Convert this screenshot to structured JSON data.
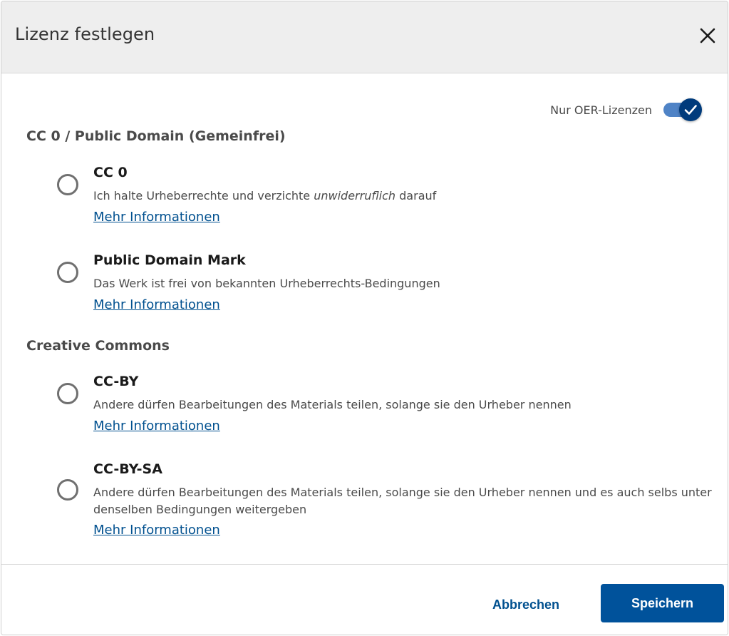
{
  "dialog": {
    "title": "Lizenz festlegen",
    "close_icon": "close-icon"
  },
  "oer_toggle": {
    "label": "Nur OER-Lizenzen",
    "checked": true,
    "knob_icon": "checkmark-icon"
  },
  "sections": [
    {
      "title": "CC 0 / Public Domain (Gemeinfrei)",
      "options": [
        {
          "title": "CC 0",
          "desc_before": "Ich halte Urheberrechte und verzichte ",
          "desc_emphasis": "unwiderruflich",
          "desc_after": " darauf",
          "link": "Mehr Informationen",
          "selected": false
        },
        {
          "title": "Public Domain Mark",
          "desc": "Das Werk ist frei von bekannten Urheberrechts-Bedingungen",
          "link": "Mehr Informationen",
          "selected": false
        }
      ]
    },
    {
      "title": "Creative Commons",
      "options": [
        {
          "title": "CC-BY",
          "desc": "Andere dürfen Bearbeitungen des Materials teilen, solange sie den Urheber nennen",
          "link": "Mehr Informationen",
          "selected": false
        },
        {
          "title": "CC-BY-SA",
          "desc": "Andere dürfen Bearbeitungen des Materials teilen, solange sie den Urheber nennen und es auch selbs unter denselben Bedingungen weitergeben",
          "link": "Mehr Informationen",
          "selected": false
        }
      ]
    }
  ],
  "footer": {
    "cancel_label": "Abbrechen",
    "save_label": "Speichern"
  },
  "colors": {
    "primary": "#00529b",
    "link": "#00508f",
    "toggle_track": "#4f83c6",
    "toggle_knob": "#003b7c",
    "header_bg": "#eeeeee"
  }
}
